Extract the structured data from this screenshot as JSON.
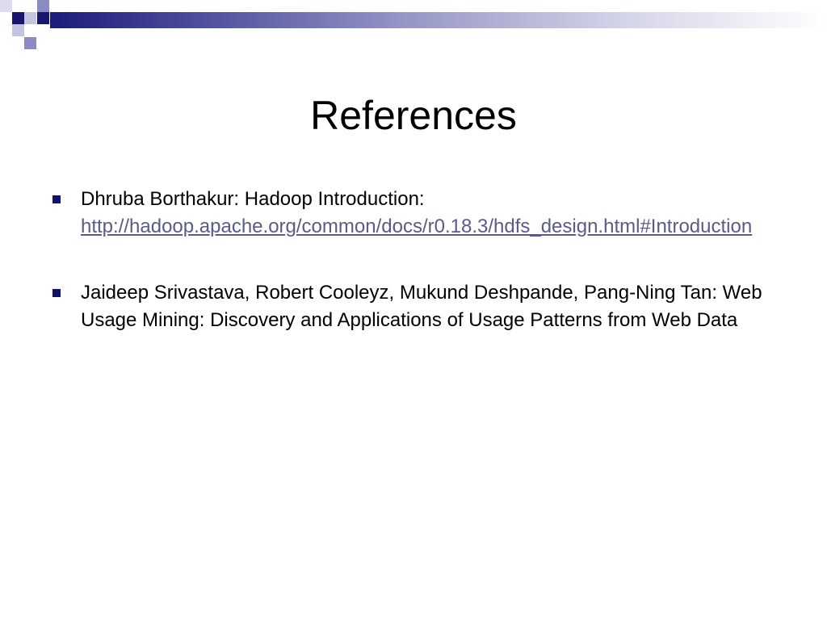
{
  "slide": {
    "title": "References",
    "references": [
      {
        "text": "Dhruba Borthakur: Hadoop Introduction:",
        "link": "http://hadoop.apache.org/common/docs/r0.18.3/hdfs_design.html#Introduction"
      },
      {
        "text": "Jaideep Srivastava, Robert Cooleyz, Mukund Deshpande, Pang-Ning Tan: Web Usage Mining: Discovery and Applications of Usage Patterns from Web Data"
      }
    ]
  },
  "colors": {
    "accent": "#16166e",
    "link": "#5a5a8c"
  }
}
